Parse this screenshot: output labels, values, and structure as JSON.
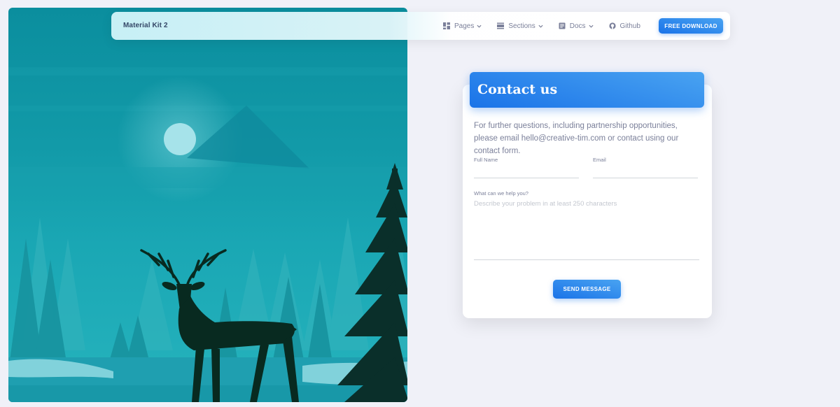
{
  "navbar": {
    "brand": "Material Kit 2",
    "items": [
      {
        "label": "Pages",
        "icon": "dashboard-icon",
        "dropdown": true
      },
      {
        "label": "Sections",
        "icon": "view-day-icon",
        "dropdown": true
      },
      {
        "label": "Docs",
        "icon": "article-icon",
        "dropdown": true
      },
      {
        "label": "Github",
        "icon": "github-icon",
        "dropdown": false
      }
    ],
    "download_label": "FREE DOWNLOAD"
  },
  "contact": {
    "title": "Contact us",
    "intro": "For further questions, including partnership opportunities, please email hello@creative-tim.com or contact using our contact form.",
    "full_name_label": "Full Name",
    "full_name_value": "",
    "email_label": "Email",
    "email_value": "",
    "message_label": "What can we help you?",
    "message_placeholder": "Describe your problem in at least 250 characters",
    "message_value": "",
    "send_label": "SEND MESSAGE"
  },
  "colors": {
    "accent": "#1a73e8",
    "accent_light": "#49a3f1",
    "text_dark": "#344767",
    "text_muted": "#7b809a",
    "page_bg": "#f0f1f8"
  },
  "illustration": {
    "subject": "deer-silhouette-forest-moon-illustration"
  }
}
